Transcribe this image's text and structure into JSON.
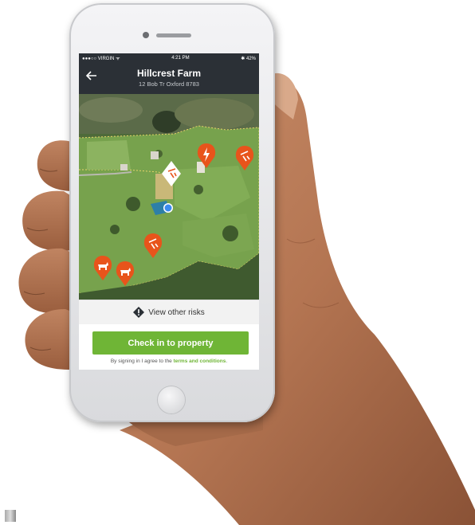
{
  "status_bar": {
    "carrier": "●●●○○ VIRGIN ᯤ",
    "time": "4:21 PM",
    "battery": "✱ 42%"
  },
  "header": {
    "back_icon": "arrow-left-icon",
    "title": "Hillcrest Farm",
    "address": "12 Bob Tr Oxford 8783"
  },
  "map": {
    "markers": [
      {
        "kind": "electrical-hazard",
        "color": "#e8541b"
      },
      {
        "kind": "fall-hazard",
        "color": "#e8541b"
      },
      {
        "kind": "fall-hazard",
        "color": "#e8541b"
      },
      {
        "kind": "selected-hazard",
        "color": "#ffffff"
      },
      {
        "kind": "livestock",
        "color": "#e8541b"
      },
      {
        "kind": "livestock",
        "color": "#e8541b"
      }
    ],
    "user_location_color": "#3b8bf0"
  },
  "risk_bar": {
    "icon": "warning-diamond-icon",
    "label": "View other risks"
  },
  "checkin": {
    "label": "Check in to property"
  },
  "terms": {
    "prefix": "By signing in I agree to the ",
    "link": "terms and conditions",
    "suffix": "."
  },
  "colors": {
    "accent": "#6fb536",
    "header": "#2b3036",
    "marker": "#e8541b"
  }
}
